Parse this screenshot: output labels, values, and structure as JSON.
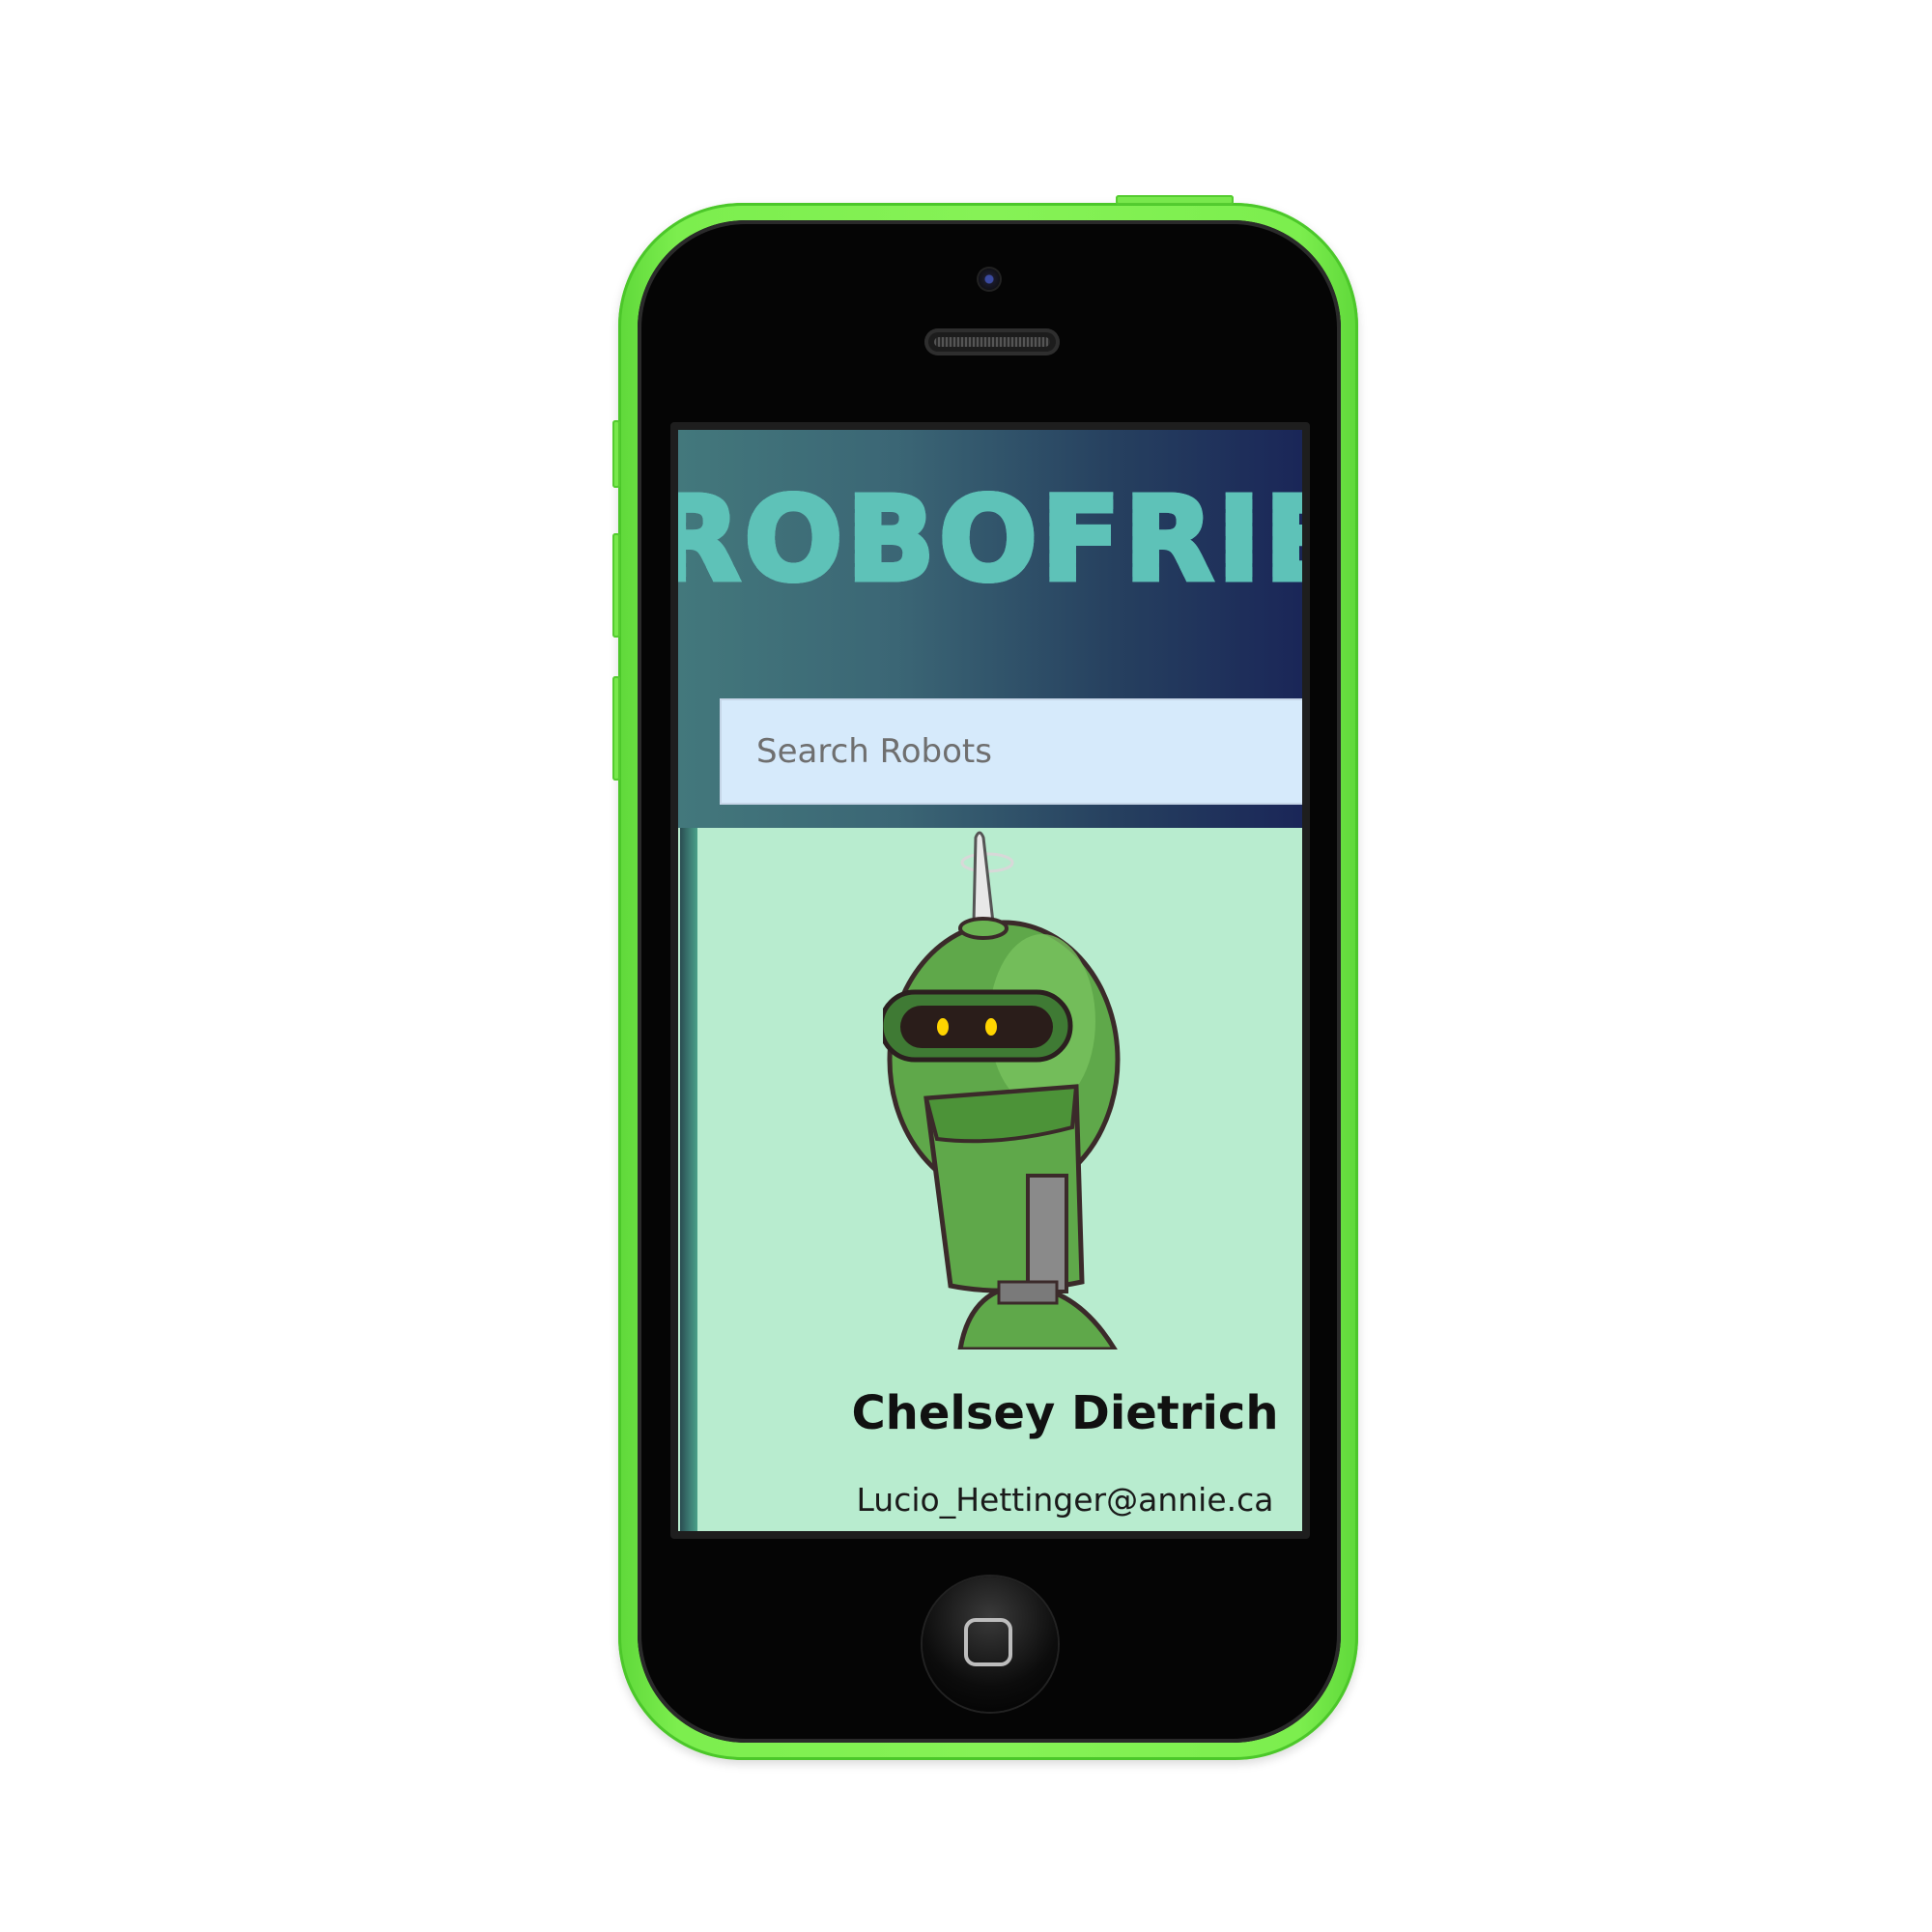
{
  "app": {
    "title": "ROBOFRIENDS"
  },
  "search": {
    "placeholder": "Search Robots",
    "value": ""
  },
  "cards": [
    {
      "name": "Chelsey Dietrich",
      "email": "Lucio_Hettinger@annie.ca",
      "avatar": "robot-avatar"
    }
  ],
  "colors": {
    "device": "#86f256",
    "header_start": "#43787c",
    "header_end": "#1a2658",
    "title": "#5ec2b8",
    "card_background": "#b8eccf",
    "search_background": "#d6eafb"
  }
}
